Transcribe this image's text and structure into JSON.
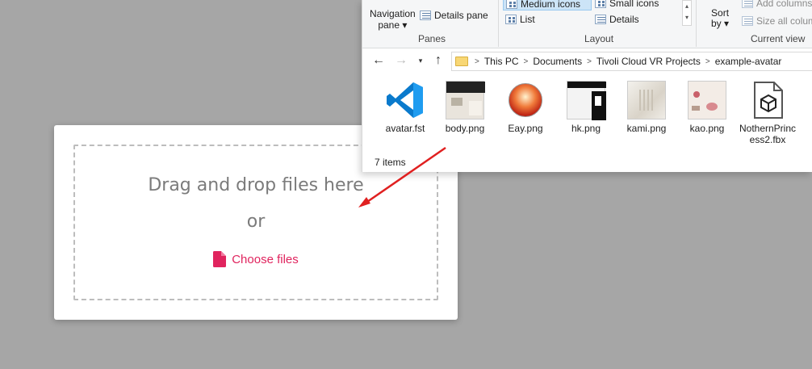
{
  "upload": {
    "title": "Drag and drop files here",
    "or_text": "or",
    "choose_label": "Choose files",
    "accent_color": "#e0245e"
  },
  "explorer": {
    "ribbon": {
      "navigation_pane_label": "Navigation",
      "navigation_pane_label2": "pane",
      "details_pane_label": "Details pane",
      "panes_caption": "Panes",
      "medium_icons": "Medium icons",
      "small_icons": "Small icons",
      "list": "List",
      "details": "Details",
      "layout_caption": "Layout",
      "sort_label": "Sort",
      "sort_label2": "by",
      "add_columns": "Add columns",
      "size_all_columns": "Size all colum",
      "current_view_caption": "Current view"
    },
    "breadcrumbs": [
      "This PC",
      "Documents",
      "Tivoli Cloud VR Projects",
      "example-avatar"
    ],
    "files": [
      {
        "name": "avatar.fst",
        "icon": "vscode-icon"
      },
      {
        "name": "body.png",
        "icon": "image-thumbnail"
      },
      {
        "name": "Eay.png",
        "icon": "image-thumbnail"
      },
      {
        "name": "hk.png",
        "icon": "image-thumbnail"
      },
      {
        "name": "kami.png",
        "icon": "image-thumbnail"
      },
      {
        "name": "kao.png",
        "icon": "image-thumbnail"
      },
      {
        "name": "NothernPrincess2.fbx",
        "icon": "3d-object-icon"
      }
    ],
    "status": "7 items"
  }
}
